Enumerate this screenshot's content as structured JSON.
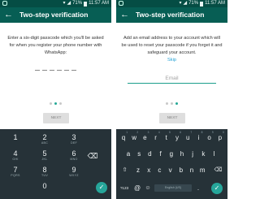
{
  "status_bar": {
    "battery": "71%",
    "time": "11:57 AM"
  },
  "screens": [
    {
      "title": "Two-step verification",
      "instruction": "Enter a six-digit passcode which you'll be asked for when you register your phone number with WhatsApp:",
      "pagination": {
        "count": 3,
        "active": 1
      },
      "next_label": "NEXT"
    },
    {
      "title": "Two-step verification",
      "instruction": "Add an email address to your account which will be used to reset your passcode if you forget it and safeguard your account.",
      "skip_label": "Skip",
      "email_placeholder": "Email",
      "pagination": {
        "count": 3,
        "active": 2
      },
      "next_label": "NEXT"
    }
  ],
  "numeric_keyboard": {
    "keys": [
      {
        "digit": "1",
        "letters": ""
      },
      {
        "digit": "2",
        "letters": "ABC"
      },
      {
        "digit": "3",
        "letters": "DEF"
      },
      {
        "digit": "4",
        "letters": "GHI"
      },
      {
        "digit": "5",
        "letters": "JKL"
      },
      {
        "digit": "6",
        "letters": "MNO"
      },
      {
        "digit": "7",
        "letters": "PQRS"
      },
      {
        "digit": "8",
        "letters": "TUV"
      },
      {
        "digit": "9",
        "letters": "WXYZ"
      },
      {
        "digit": "0",
        "letters": ""
      }
    ],
    "icons": {
      "backspace": "backspace-icon",
      "go": "checkmark-icon"
    }
  },
  "qwerty_keyboard": {
    "row1": [
      {
        "key": "q",
        "sup": "1"
      },
      {
        "key": "w",
        "sup": "2"
      },
      {
        "key": "e",
        "sup": "3"
      },
      {
        "key": "r",
        "sup": "4"
      },
      {
        "key": "t",
        "sup": "5"
      },
      {
        "key": "y",
        "sup": "6"
      },
      {
        "key": "u",
        "sup": "7"
      },
      {
        "key": "i",
        "sup": "8"
      },
      {
        "key": "o",
        "sup": "9"
      },
      {
        "key": "p",
        "sup": "0"
      }
    ],
    "row2": [
      "a",
      "s",
      "d",
      "f",
      "g",
      "h",
      "j",
      "k",
      "l"
    ],
    "row3": [
      "z",
      "x",
      "c",
      "v",
      "b",
      "n",
      "m"
    ],
    "bottom": {
      "symbols": "?123",
      "at": "@",
      "period": ".",
      "space_label": "English (US)"
    },
    "icons": {
      "shift": "shift-icon",
      "backspace": "backspace-icon",
      "emoji": "emoji-icon",
      "go": "checkmark-icon"
    }
  },
  "colors": {
    "status_bar": "#054d44",
    "app_bar": "#075e54",
    "accent": "#25a896",
    "keyboard_bg": "#263238",
    "link": "#21a0d5"
  }
}
